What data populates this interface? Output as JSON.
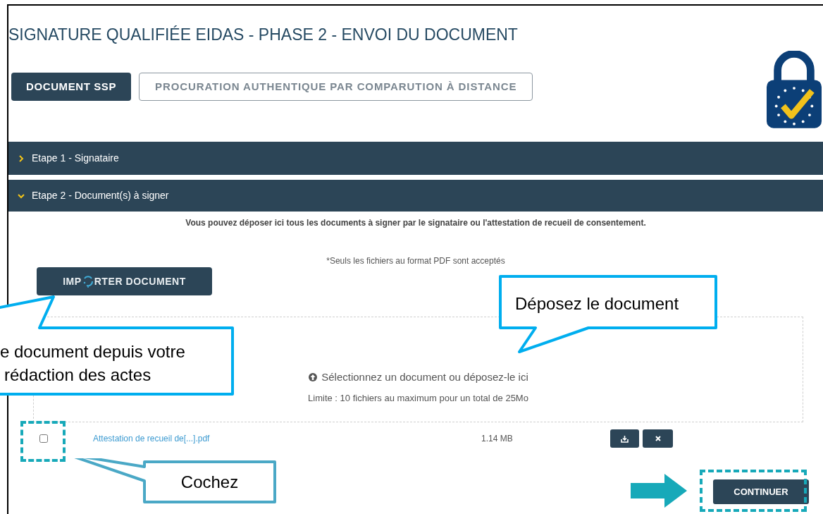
{
  "title": "SIGNATURE QUALIFIÉE EIDAS - PHASE 2 - ENVOI DU DOCUMENT",
  "tabs": [
    {
      "label": "DOCUMENT SSP",
      "selected": true
    },
    {
      "label": "PROCURATION AUTHENTIQUE PAR COMPARUTION À DISTANCE",
      "selected": false
    }
  ],
  "steps": [
    {
      "label": "Etape 1 - Signataire",
      "expanded": false
    },
    {
      "label": "Etape 2 - Document(s) à signer",
      "expanded": true
    }
  ],
  "upload": {
    "description": "Vous pouvez déposer ici tous les documents à signer par le signataire ou l'attestation de recueil de consentement.",
    "note": "*Seuls les fichiers au format PDF sont acceptés",
    "import_button": {
      "label_start": "IMP",
      "label_end": "RTER DOCUMENT",
      "loading": true
    },
    "dropzone": {
      "prompt": "Sélectionnez un document ou déposez-le ici",
      "limit": "Limite : 10 fichiers au maximum pour un total de 25Mo"
    }
  },
  "files": [
    {
      "name": "Attestation de recueil de[...].pdf",
      "size": "1.14 MB",
      "checked": false
    }
  ],
  "continue_button": "CONTINUER",
  "annotations": {
    "import_callout": [
      "e document depuis votre",
      "rédaction des actes"
    ],
    "drop_callout": [
      "Déposez le document"
    ],
    "checkbox_callout": [
      "Cochez"
    ]
  }
}
